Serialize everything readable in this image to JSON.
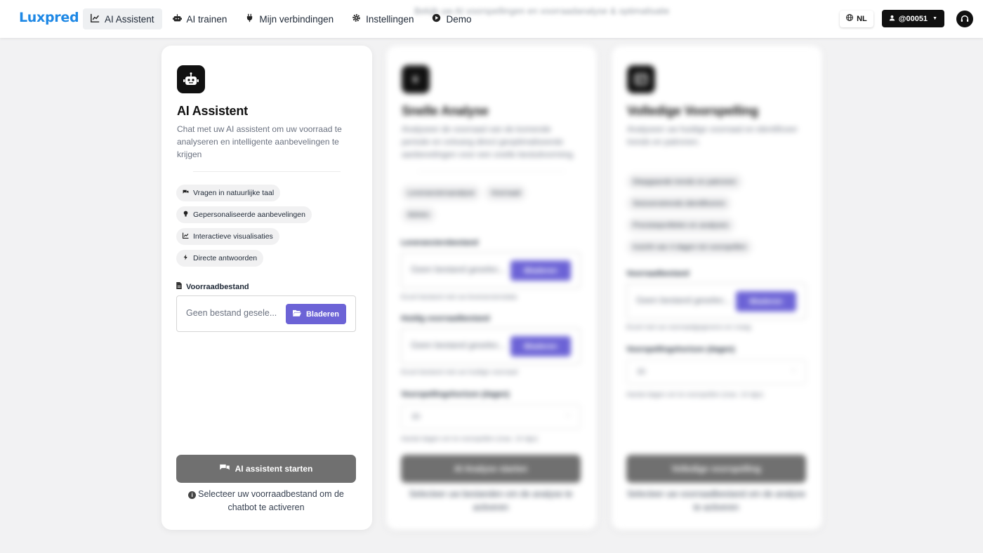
{
  "brand": {
    "logo": "Luxpred"
  },
  "banner": {
    "text": "Bekijk uw AI voorspellingen en voorraadanalyse & optimalisatie"
  },
  "nav": {
    "items": [
      {
        "label": "AI Assistent",
        "icon": "chart-line-icon",
        "active": true
      },
      {
        "label": "AI trainen",
        "icon": "robot-icon"
      },
      {
        "label": "Mijn verbindingen",
        "icon": "plug-icon"
      },
      {
        "label": "Instellingen",
        "icon": "gear-icon"
      },
      {
        "label": "Demo",
        "icon": "play-circle-icon"
      }
    ],
    "language": "NL",
    "user": "@00051",
    "support_icon": "headset-icon"
  },
  "assistant_card": {
    "title": "AI Assistent",
    "description": "Chat met uw AI assistent om uw voorraad te analyseren en intelligente aanbevelingen te krijgen",
    "features": [
      {
        "label": "Vragen in natuurlijke taal",
        "icon": "comments-icon"
      },
      {
        "label": "Gepersonaliseerde aanbevelingen",
        "icon": "lightbulb-icon"
      },
      {
        "label": "Interactieve visualisaties",
        "icon": "chart-line-icon"
      },
      {
        "label": "Directe antwoorden",
        "icon": "bolt-icon"
      }
    ],
    "file_label": "Voorraadbestand",
    "file_placeholder": "Geen bestand gesele...",
    "browse_label": "Bladeren",
    "start_label": "AI assistent starten",
    "note": "Selecteer uw voorraadbestand om de chatbot te activeren"
  },
  "quick_card": {
    "title": "Snelle Analyse",
    "description": "Analyseer de voorraad van de komende periode en ontvang direct geoptimaliseerde aanbevelingen voor een snelle besluitvorming.",
    "features": [
      "Leveranciersanalyse",
      "Voorraad",
      "Advies"
    ],
    "file1_label": "Leveranciersbestand",
    "file1_placeholder": "Geen bestand geselec...",
    "file1_hint": "Excel bestand met uw leveranciersdata",
    "file2_label": "Huidig voorraadbestand",
    "file2_placeholder": "Geen bestand geselec...",
    "file2_hint": "Excel bestand met uw huidige voorraad",
    "browse_label": "Bladeren",
    "horizon_label": "Voorspellingshorizon (dagen)",
    "horizon_value": "30",
    "horizon_hint": "Aantal dagen om te voorspellen (max. 14 dgn)",
    "start_label": "AI Analyse starten",
    "note": "Selecteer uw bestanden om de analyse te activeren"
  },
  "full_card": {
    "title": "Volledige Voorspelling",
    "description": "Analyseer uw huidige voorraad en identificeer trends en patronen.",
    "features": [
      "Diepgaande trends en patronen",
      "Seizoenstrends identificeren",
      "Precisieprofielen en analyses",
      "Inzicht van 4 dagen tot voorspellen"
    ],
    "file_label": "Voorraadbestand",
    "file_placeholder": "Geen bestand geselec...",
    "file_hint": "Excel met uw voorraadgegevens en vraag",
    "browse_label": "Bladeren",
    "horizon_label": "Voorspellingshorizon (dagen)",
    "horizon_value": "30",
    "horizon_hint": "Aantal dagen om te voorspellen (max. 14 dgn)",
    "start_label": "Volledige voorspelling",
    "note": "Selecteer uw voorraadbestand om de analyse te activeren"
  }
}
